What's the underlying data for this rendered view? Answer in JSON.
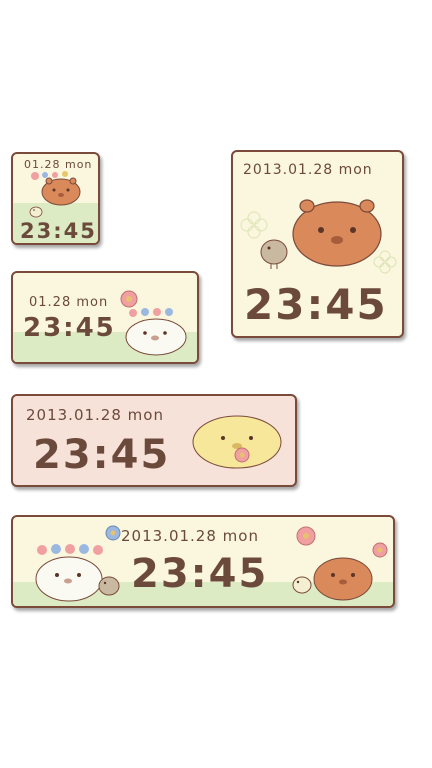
{
  "widgets": [
    {
      "size": "1x1",
      "date": "01.28 mon",
      "time": "23:45"
    },
    {
      "size": "2x2",
      "date": "2013.01.28 mon",
      "time": "23:45"
    },
    {
      "size": "2x1",
      "date": "01.28 mon",
      "time": "23:45"
    },
    {
      "size": "3x1",
      "date": "2013.01.28 mon",
      "time": "23:45"
    },
    {
      "size": "4x1",
      "date": "2013.01.28 mon",
      "time": "23:45"
    }
  ],
  "colors": {
    "text": "#6b4a3c",
    "border": "#7a4a3a",
    "cream": "#fbf6de",
    "pink": "#f7e2da",
    "grass": "#dcebc4",
    "capybara_brown": "#d9895a",
    "capybara_yellow": "#f6e79a",
    "capybara_white": "#fbfaf2"
  },
  "icons": [
    "capybara-brown-icon",
    "capybara-yellow-icon",
    "capybara-white-icon",
    "bird-icon",
    "flower-icon",
    "flower-crown-icon"
  ]
}
